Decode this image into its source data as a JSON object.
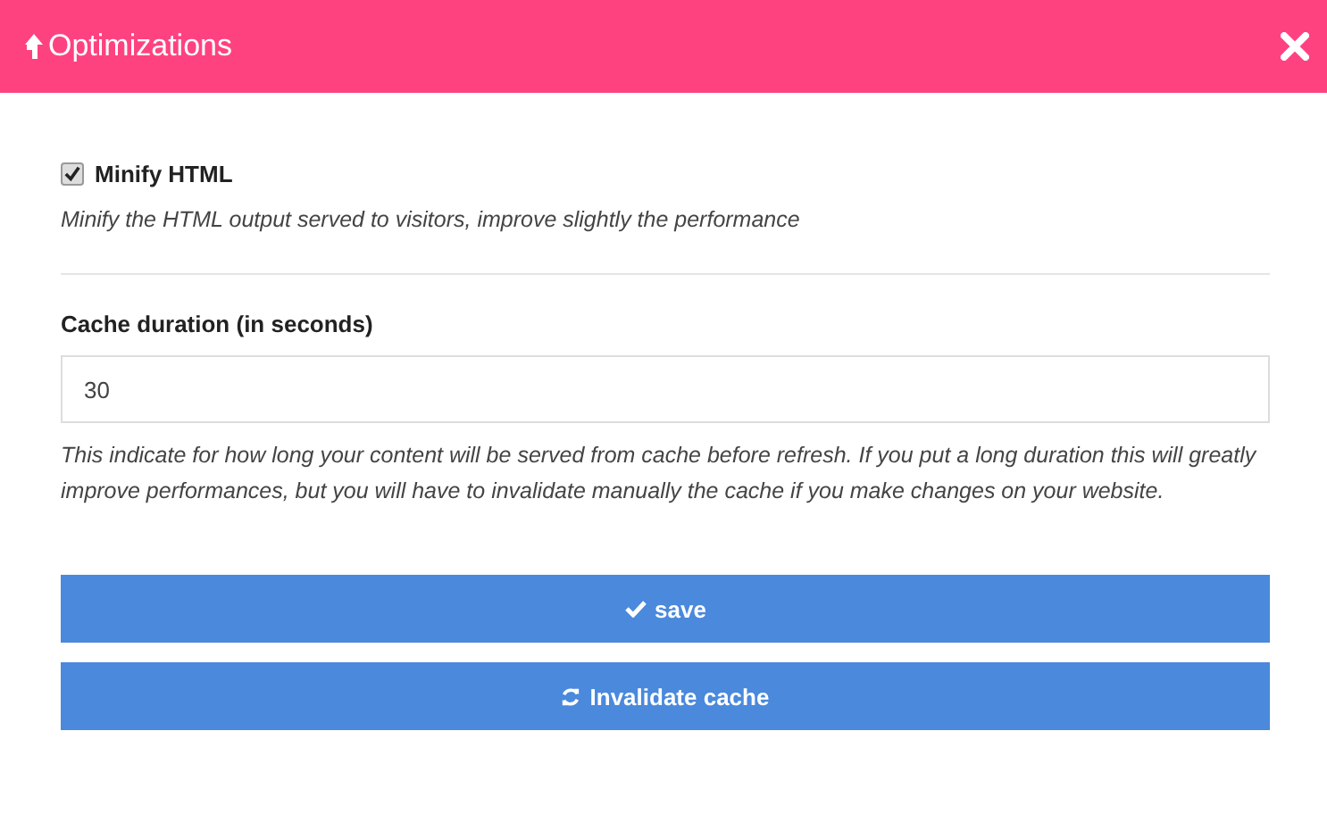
{
  "dialog": {
    "title": "Optimizations"
  },
  "minify": {
    "label": "Minify HTML",
    "checked": true,
    "help": "Minify the HTML output served to visitors, improve slightly the performance"
  },
  "cache": {
    "label": "Cache duration (in seconds)",
    "value": "30",
    "help": "This indicate for how long your content will be served from cache before refresh. If you put a long duration this will greatly improve performances, but you will have to invalidate manually the cache if you make changes on your website."
  },
  "buttons": [
    {
      "kind": "save",
      "label": "save"
    },
    {
      "kind": "refresh",
      "label": "Invalidate cache"
    }
  ]
}
